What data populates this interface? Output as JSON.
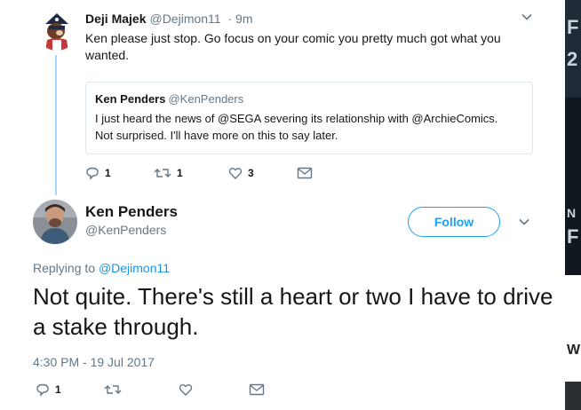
{
  "reply_tweet": {
    "display_name": "Deji Majek",
    "handle": "@Dejimon11",
    "time": "· 9m",
    "text": "Ken please just stop. Go focus on your comic you pretty much got what you wanted.",
    "quoted": {
      "display_name": "Ken Penders",
      "handle": "@KenPenders",
      "text": "I just heard the news of @SEGA severing its relationship with @ArchieComics. Not surprised. I'll have more on this to say later."
    },
    "actions": {
      "replies": "1",
      "retweets": "1",
      "likes": "3"
    }
  },
  "main_tweet": {
    "display_name": "Ken Penders",
    "handle": "@KenPenders",
    "follow_label": "Follow",
    "replying_prefix": "Replying to",
    "replying_to": "@Dejimon11",
    "text": "Not quite. There's still a heart or two I have to drive a stake through.",
    "timestamp": "4:30 PM - 19 Jul 2017",
    "actions": {
      "replies": "1"
    }
  },
  "right_strip": {
    "letters": [
      "F",
      "2",
      "N",
      "F",
      "W"
    ]
  },
  "colors": {
    "accent": "#1da1f2",
    "thread_line": "#a4d9f9",
    "muted": "#657786"
  },
  "icons": [
    "chevron-down-icon",
    "reply-icon",
    "retweet-icon",
    "like-icon",
    "dm-icon"
  ]
}
